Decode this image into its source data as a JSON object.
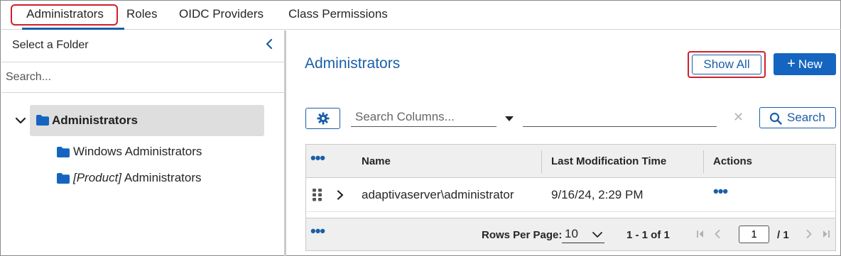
{
  "tabs": [
    {
      "label": "Administrators"
    },
    {
      "label": "Roles"
    },
    {
      "label": "OIDC Providers"
    },
    {
      "label": "Class Permissions"
    }
  ],
  "left_panel": {
    "title": "Select a Folder",
    "search_placeholder": "Search...",
    "tree": {
      "root_label": "Administrators",
      "children": [
        {
          "label": "Windows Administrators"
        },
        {
          "tag": "[Product]",
          "label": "Administrators"
        }
      ]
    }
  },
  "main": {
    "title": "Administrators",
    "show_all_label": "Show All",
    "new_label": "New",
    "new_icon": "+",
    "filter": {
      "column_placeholder": "Search Columns...",
      "value": "",
      "clear_icon": "✕",
      "search_label": "Search"
    },
    "grid": {
      "columns": [
        "Name",
        "Last Modification Time",
        "Actions"
      ],
      "rows": [
        {
          "name": "adaptivaserver\\administrator",
          "modified": "9/16/24, 2:29 PM"
        }
      ],
      "menu_icon": "•••",
      "footer": {
        "rows_per_page_label": "Rows Per Page:",
        "rows_per_page": "10",
        "range": "1 - 1 of 1",
        "page": "1",
        "total_pages": "/ 1"
      }
    }
  },
  "colors": {
    "accent": "#1a5fa8",
    "primary_button": "#1565c0",
    "highlight_outline": "#d0202a",
    "folder": "#1565c0"
  }
}
